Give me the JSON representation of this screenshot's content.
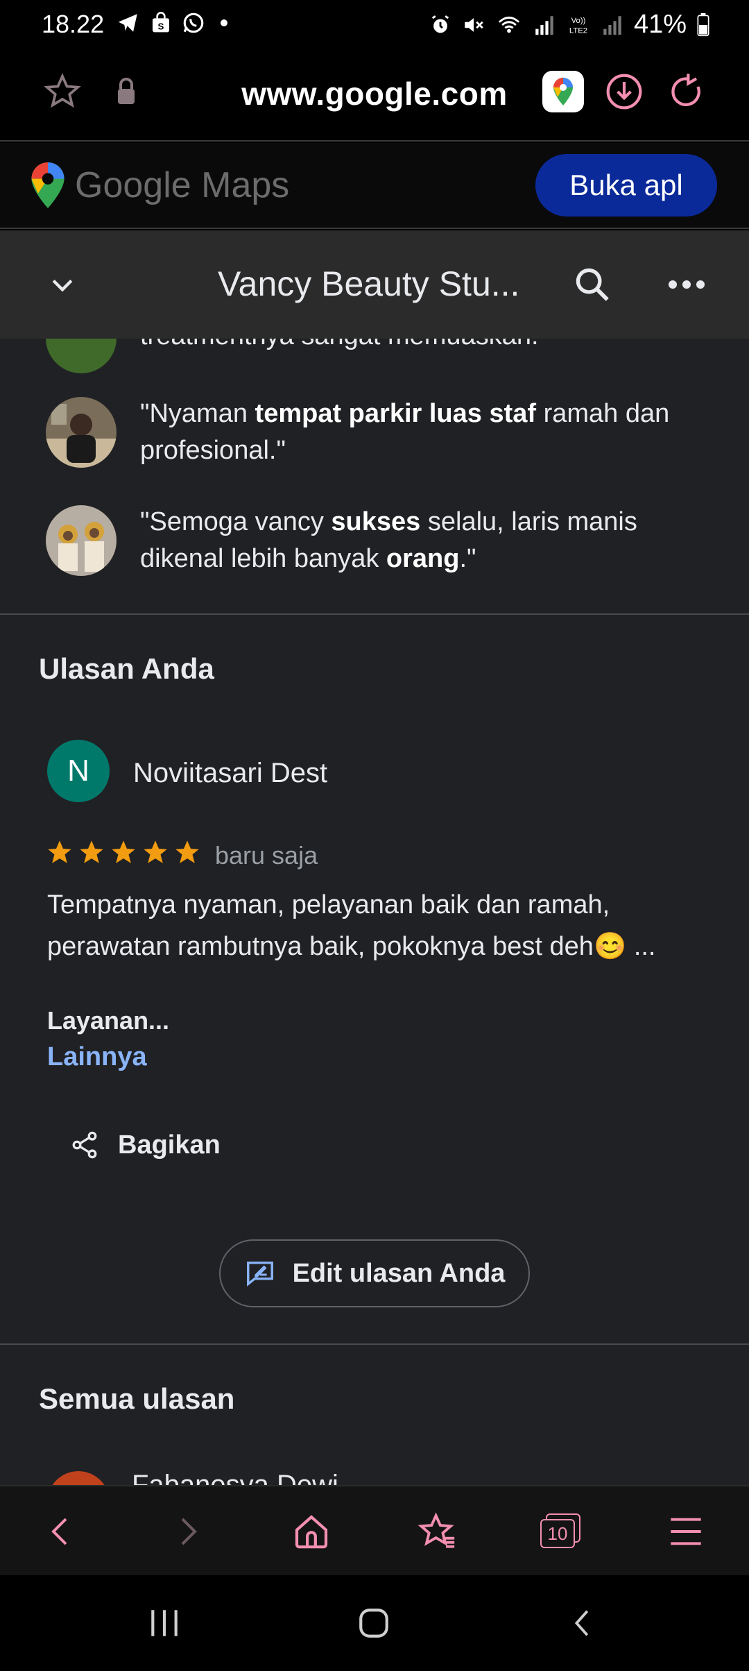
{
  "status_bar": {
    "time": "18.22",
    "battery": "41%"
  },
  "browser": {
    "url": "www.google.com"
  },
  "maps_banner": {
    "logo_text": "Google Maps",
    "open_app_label": "Buka apl"
  },
  "place_header": {
    "title": "Vancy Beauty Stu..."
  },
  "snippets": [
    {
      "parts": [
        {
          "text": "treatmentnya sangat memuaskan.",
          "bold": false
        }
      ]
    },
    {
      "parts": [
        {
          "text": "\"Nyaman ",
          "bold": false
        },
        {
          "text": "tempat parkir luas staf",
          "bold": true
        },
        {
          "text": " ramah dan profesional.\"",
          "bold": false
        }
      ]
    },
    {
      "parts": [
        {
          "text": "\"Semoga vancy ",
          "bold": false
        },
        {
          "text": "sukses",
          "bold": true
        },
        {
          "text": " selalu, laris manis dikenal lebih banyak ",
          "bold": false
        },
        {
          "text": "orang",
          "bold": true
        },
        {
          "text": ".\"",
          "bold": false
        }
      ]
    }
  ],
  "your_review": {
    "section_title": "Ulasan Anda",
    "avatar_initial": "N",
    "user_name": "Noviitasari Dest",
    "rating": 5,
    "time": "baru saja",
    "text": "Tempatnya nyaman, pelayanan baik dan ramah, perawatan rambutnya baik, pokoknya best deh😊 ...",
    "services_label": "Layanan...",
    "more_label": "Lainnya",
    "share_label": "Bagikan",
    "edit_label": "Edit ulasan Anda"
  },
  "all_reviews": {
    "section_title": "Semua ulasan",
    "next_reviewer": "Fabanesya Dewi"
  },
  "bottom_nav": {
    "tab_count": "10"
  },
  "colors": {
    "star": "#f29c11",
    "link": "#8ab4f8",
    "open_button": "#0b2a9a",
    "avatar": "#00796b",
    "accent_pink": "#f48fb1"
  }
}
